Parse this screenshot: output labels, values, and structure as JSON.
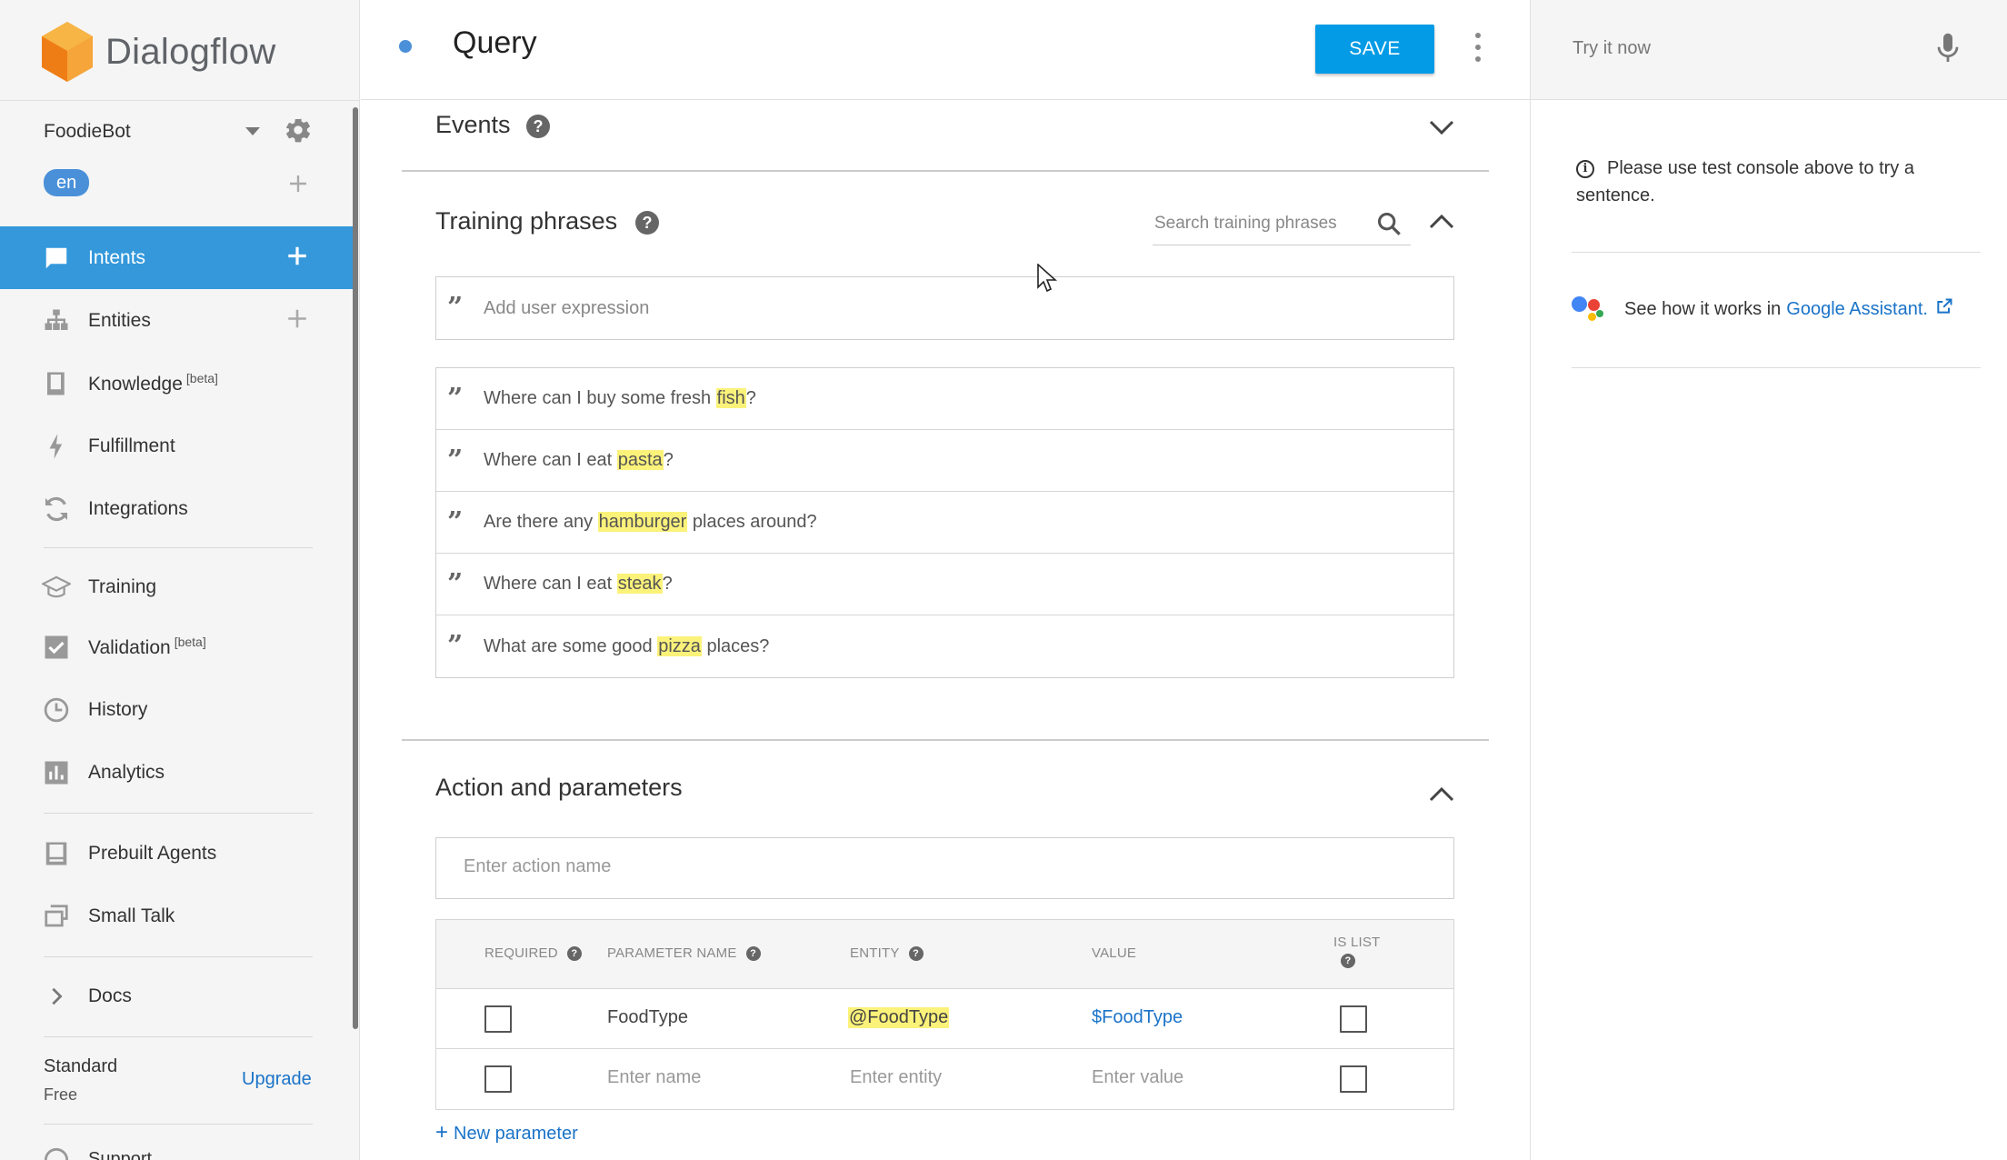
{
  "app": {
    "name": "Dialogflow"
  },
  "sidebar": {
    "agent": {
      "name": "FoodieBot",
      "language": "en"
    },
    "nav": [
      {
        "label": "Intents",
        "icon": "chat-bubble-icon",
        "active": true,
        "has_add": true
      },
      {
        "label": "Entities",
        "icon": "hierarchy-icon",
        "active": false,
        "has_add": true
      },
      {
        "label": "Knowledge",
        "badge": "[beta]",
        "icon": "book-icon",
        "active": false
      },
      {
        "label": "Fulfillment",
        "icon": "lightning-icon",
        "active": false
      },
      {
        "label": "Integrations",
        "icon": "sync-icon",
        "active": false
      },
      {
        "label": "Training",
        "icon": "graduation-cap-icon",
        "active": false
      },
      {
        "label": "Validation",
        "badge": "[beta]",
        "icon": "checkbox-icon",
        "active": false
      },
      {
        "label": "History",
        "icon": "clock-icon",
        "active": false
      },
      {
        "label": "Analytics",
        "icon": "bar-chart-icon",
        "active": false
      },
      {
        "label": "Prebuilt Agents",
        "icon": "agents-book-icon",
        "active": false
      },
      {
        "label": "Small Talk",
        "icon": "chat-windows-icon",
        "active": false
      },
      {
        "label": "Docs",
        "icon": "chevron-right-icon",
        "active": false
      }
    ],
    "plan": {
      "name": "Standard",
      "tier": "Free",
      "upgrade_label": "Upgrade"
    },
    "support_label": "Support"
  },
  "header": {
    "title": "Query",
    "save_label": "SAVE"
  },
  "events": {
    "title": "Events"
  },
  "training": {
    "title": "Training phrases",
    "search_placeholder": "Search training phrases",
    "add_placeholder": "Add user expression",
    "phrases": [
      {
        "before": "Where can I buy some fresh ",
        "entity": "fish",
        "after": "?"
      },
      {
        "before": "Where can I eat ",
        "entity": "pasta",
        "after": "?"
      },
      {
        "before": "Are there any ",
        "entity": "hamburger",
        "after": " places around?"
      },
      {
        "before": "Where can I eat ",
        "entity": "steak",
        "after": "?"
      },
      {
        "before": "What are some good ",
        "entity": "pizza",
        "after": " places?"
      }
    ]
  },
  "action": {
    "title": "Action and parameters",
    "action_placeholder": "Enter action name",
    "columns": {
      "required": "REQUIRED",
      "name": "PARAMETER NAME",
      "entity": "ENTITY",
      "value": "VALUE",
      "is_list": "IS LIST"
    },
    "rows": [
      {
        "name": "FoodType",
        "entity": "@FoodType",
        "value": "$FoodType",
        "required": false,
        "is_list": false
      }
    ],
    "placeholders": {
      "name": "Enter name",
      "entity": "Enter entity",
      "value": "Enter value"
    },
    "new_param_label": "New parameter"
  },
  "console": {
    "try_placeholder": "Try it now",
    "info_text": "Please use test console above to try a sentence.",
    "ga_text": "See how it works in",
    "ga_link": "Google Assistant."
  },
  "colors": {
    "accent": "#039be5",
    "active_nav": "#3498db",
    "highlight": "#fbf27a",
    "link": "#1a73c8"
  }
}
